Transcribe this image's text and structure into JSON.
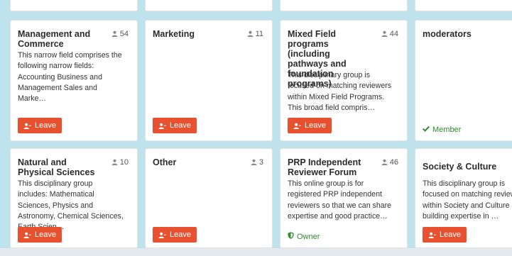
{
  "groups": [
    {
      "title": "Management and Commerce",
      "count": "54",
      "description": "This narrow field comprises the following narrow fields: Accounting Business and Management Sales and Marke…",
      "action": "Leave"
    },
    {
      "title": "Marketing",
      "count": "11",
      "description": "",
      "action": "Leave"
    },
    {
      "title": "Mixed Field programs (including pathways and foundation programs)",
      "count": "44",
      "description": "This disciplinary group is focused on matching reviewers within Mixed Field Programs. This broad field compris…",
      "action": "Leave"
    },
    {
      "title": "moderators",
      "count": "",
      "description": "",
      "status": "Member"
    },
    {
      "title": "Natural and Physical Sciences",
      "count": "10",
      "description": "This disciplinary group includes: Mathematical Sciences, Physics and Astronomy, Chemical Sciences, Earth Scien…",
      "action": "Leave"
    },
    {
      "title": "Other",
      "count": "3",
      "description": "",
      "action": "Leave"
    },
    {
      "title": "PRP Independent Reviewer Forum",
      "count": "46",
      "description": "This online group is for registered PRP independent reviewers so that we can share expertise and good practice…",
      "status": "Owner"
    },
    {
      "title": "Society & Culture",
      "count": "",
      "description": "This disciplinary group is focused on matching reviewers within Society and Culture and building expertise in …",
      "action": "Leave"
    }
  ],
  "colors": {
    "leave_button": "#e8512f",
    "status_green": "#2e8b2e",
    "page_bg": "#bfe3ec"
  }
}
